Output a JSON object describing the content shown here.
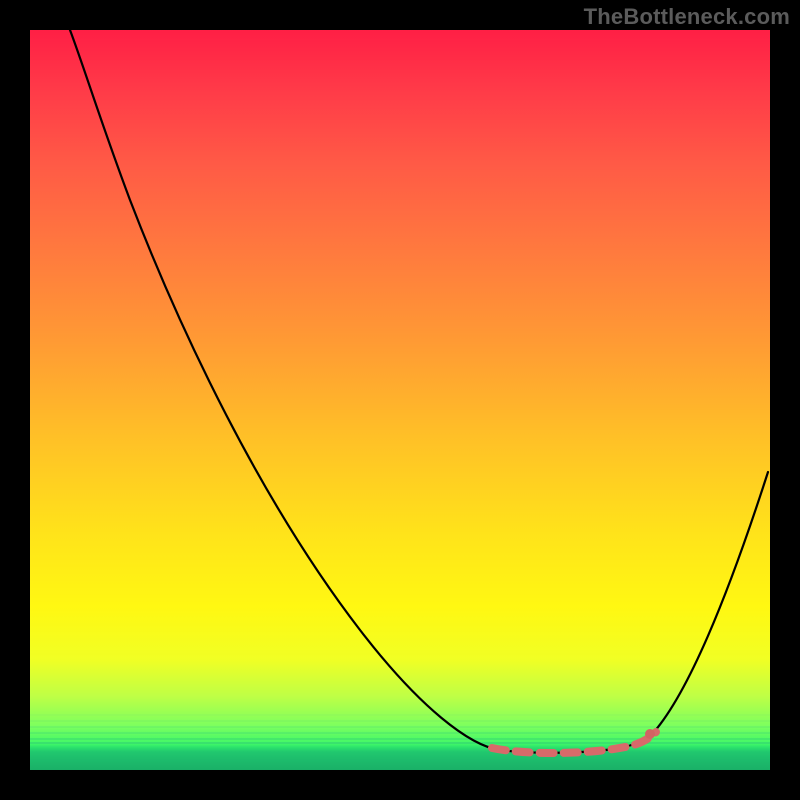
{
  "watermark": "TheBottleneck.com",
  "colors": {
    "gradient_top": "#ff1f45",
    "gradient_mid": "#ffe31a",
    "gradient_bottom": "#1ab067",
    "curve_stroke": "#000000",
    "highlight_stroke": "#d76a6a",
    "frame_bg": "#000000"
  },
  "chart_data": {
    "type": "line",
    "title": "",
    "xlabel": "",
    "ylabel": "",
    "xlim": [
      0,
      100
    ],
    "ylim": [
      0,
      100
    ],
    "grid": false,
    "legend": null,
    "note": "Background is a vertical red→yellow→green heat gradient; values below are curve height read as percent of plot height from bottom (0 = bottom/green, 100 = top/red). x is percent across plot width.",
    "series": [
      {
        "name": "bottleneck-curve",
        "x": [
          5,
          10,
          15,
          20,
          25,
          30,
          35,
          40,
          45,
          50,
          55,
          60,
          63,
          66,
          70,
          74,
          78,
          80,
          82,
          84,
          86,
          90,
          95,
          100
        ],
        "values": [
          100,
          94,
          86,
          77,
          68,
          58,
          49,
          40,
          31,
          23,
          16,
          10,
          5,
          3,
          2,
          2,
          2,
          2,
          3,
          4,
          6,
          12,
          24,
          40
        ]
      }
    ],
    "highlight_region": {
      "description": "pink dashed segment marking the valley/optimal zone",
      "x_start": 62,
      "x_end": 85,
      "approx_y": 2
    },
    "marker_point": {
      "x": 84,
      "y": 5
    }
  }
}
